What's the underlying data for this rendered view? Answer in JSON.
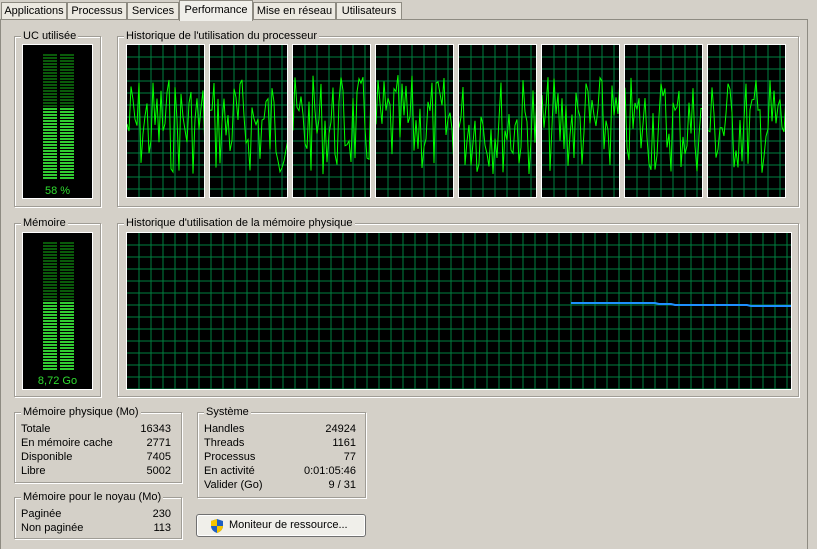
{
  "tabs": [
    {
      "label": "Applications"
    },
    {
      "label": "Processus"
    },
    {
      "label": "Services"
    },
    {
      "label": "Performance"
    },
    {
      "label": "Mise en réseau"
    },
    {
      "label": "Utilisateurs"
    }
  ],
  "active_tab": "Performance",
  "cpu": {
    "title": "UC utilisée",
    "value_label": "58 %",
    "usage_fraction": 0.58
  },
  "cpu_history": {
    "title": "Historique de l'utilisation du processeur",
    "core_count": 8
  },
  "memory": {
    "title": "Mémoire",
    "value_label": "8,72 Go",
    "usage_fraction": 0.53
  },
  "memory_history": {
    "title": "Historique d'utilisation de la mémoire physique"
  },
  "physical_memory": {
    "title": "Mémoire physique (Mo)",
    "rows": [
      {
        "label": "Totale",
        "value": "16343"
      },
      {
        "label": "En mémoire cache",
        "value": "2771"
      },
      {
        "label": "Disponible",
        "value": "7405"
      },
      {
        "label": "Libre",
        "value": "5002"
      }
    ]
  },
  "kernel_memory": {
    "title": "Mémoire pour le noyau (Mo)",
    "rows": [
      {
        "label": "Paginée",
        "value": "230"
      },
      {
        "label": "Non paginée",
        "value": "113"
      }
    ]
  },
  "system": {
    "title": "Système",
    "rows": [
      {
        "label": "Handles",
        "value": "24924"
      },
      {
        "label": "Threads",
        "value": "1161"
      },
      {
        "label": "Processus",
        "value": "77"
      },
      {
        "label": "En activité",
        "value": "0:01:05:46"
      },
      {
        "label": "Valider (Go)",
        "value": "9 / 31"
      }
    ]
  },
  "resource_monitor_button": {
    "label": "Moniteur de ressource...",
    "icon": "uac-shield-icon"
  },
  "colors": {
    "graph_bg": "#000000",
    "grid": "#008040",
    "cpu_line": "#00ff00",
    "mem_line": "#1e90ff",
    "meter_on": "#32cd32",
    "meter_off": "#0a5a0a"
  }
}
